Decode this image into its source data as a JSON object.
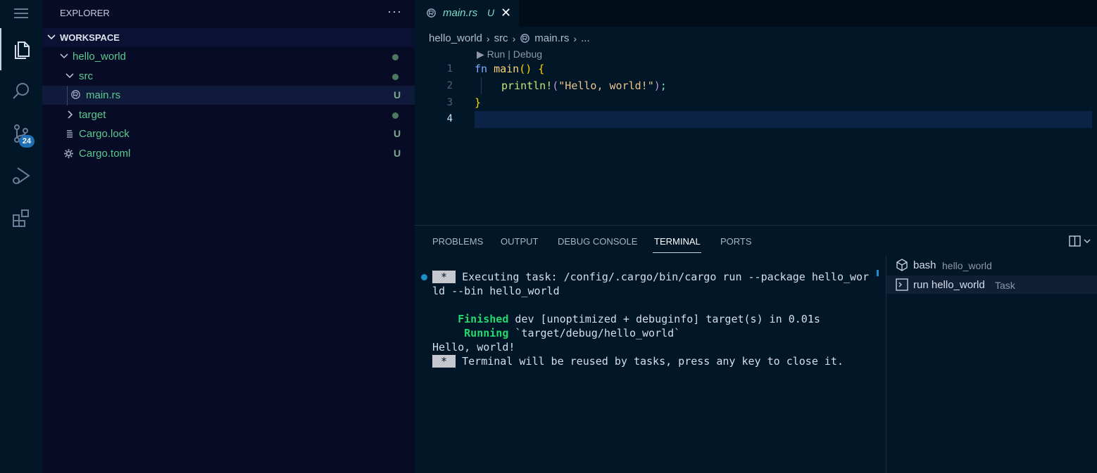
{
  "activity_bar": {
    "scm_badge": "24",
    "icons": [
      "explorer-icon",
      "search-icon",
      "source-control-icon",
      "run-debug-icon",
      "extensions-icon"
    ]
  },
  "sidebar": {
    "title": "EXPLORER",
    "more": "···",
    "workspace_label": "WORKSPACE",
    "tree": [
      {
        "label": "hello_world",
        "status": "dot"
      },
      {
        "label": "src",
        "status": "dot"
      },
      {
        "label": "main.rs",
        "status": "U"
      },
      {
        "label": "target",
        "status": "dot"
      },
      {
        "label": "Cargo.lock",
        "status": "U"
      },
      {
        "label": "Cargo.toml",
        "status": "U"
      }
    ]
  },
  "editor": {
    "tab": {
      "label": "main.rs",
      "status": "U",
      "close": "✕"
    },
    "breadcrumb": [
      "hello_world",
      "src",
      "main.rs",
      "..."
    ],
    "codelens": "▶ Run | Debug",
    "line_numbers": [
      "1",
      "2",
      "3",
      "4"
    ],
    "code": {
      "l1_kw": "fn",
      "l1_name": " main",
      "l1_rest": "() {",
      "l2_macro": "println!",
      "l2_open": "(",
      "l2_str": "\"Hello, world!\"",
      "l2_close": ")",
      "l2_semi": ";",
      "l3": "}"
    }
  },
  "panel": {
    "tabs": [
      "PROBLEMS",
      "OUTPUT",
      "DEBUG CONSOLE",
      "TERMINAL",
      "PORTS"
    ],
    "active_tab": "TERMINAL",
    "terminal": {
      "star": " * ",
      "line1": " Executing task: /config/.cargo/bin/cargo run --package hello_wor",
      "line2": "ld --bin hello_world",
      "finished_kw": "Finished",
      "finished_rest": " dev [unoptimized + debuginfo] target(s) in 0.01s",
      "running_kw": "Running",
      "running_rest": " `target/debug/hello_world`",
      "output": "Hello, world!",
      "reuse": " Terminal will be reused by tasks, press any key to close it."
    },
    "terminals": [
      {
        "name": "bash",
        "sub": "hello_world"
      },
      {
        "name": "run hello_world",
        "sub": "Task"
      }
    ]
  }
}
